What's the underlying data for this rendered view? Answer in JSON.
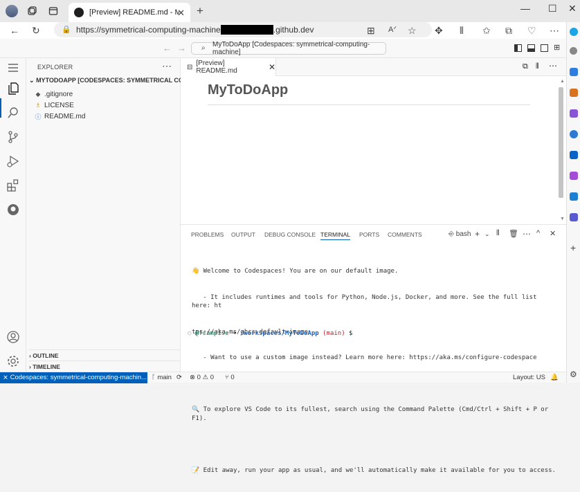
{
  "browser": {
    "tab_title": "[Preview] README.md - MyToDo",
    "url_prefix": "https://symmetrical-computing-machine",
    "url_suffix": ".github.dev"
  },
  "vscode": {
    "command_center": "MyToDoApp [Codespaces: symmetrical-computing-machine]",
    "sidebar": {
      "title": "EXPLORER",
      "folder": "MYTODOAPP [CODESPACES: SYMMETRICAL COMP...",
      "files": [
        {
          "name": ".gitignore",
          "icon": "git-icon"
        },
        {
          "name": "LICENSE",
          "icon": "license-icon"
        },
        {
          "name": "README.md",
          "icon": "info-icon"
        }
      ],
      "outline": "OUTLINE",
      "timeline": "TIMELINE"
    },
    "editor": {
      "tab_label": "[Preview] README.md",
      "heading": "MyToDoApp"
    },
    "panel": {
      "tabs": [
        "PROBLEMS",
        "OUTPUT",
        "DEBUG CONSOLE",
        "TERMINAL",
        "PORTS",
        "COMMENTS"
      ],
      "active_tab": "TERMINAL",
      "shell": "bash",
      "terminal_lines": [
        "👋 Welcome to Codespaces! You are on our default image.",
        "   - It includes runtimes and tools for Python, Node.js, Docker, and more. See the full list here: ht",
        "tps://aka.ms/ghcs-default-image",
        "   - Want to use a custom image instead? Learn more here: https://aka.ms/configure-codespace",
        "",
        "🔍 To explore VS Code to its fullest, search using the Command Palette (Cmd/Ctrl + Shift + P or F1).",
        "",
        "📝 Edit away, run your app as usual, and we'll automatically make it available for you to access."
      ],
      "prompt_user": "@fcampise",
      "prompt_arrow": "➜",
      "prompt_path": "/workspaces/MyToDoApp",
      "prompt_branch": "(main)",
      "prompt_symbol": "$"
    },
    "status": {
      "remote": "Codespaces: symmetrical-computing-machin...",
      "branch": "main",
      "errors": "0",
      "warnings": "0",
      "ports": "0",
      "layout": "Layout: US"
    }
  },
  "colors": {
    "accent": "#005fb8",
    "status_remote_bg": "#005fb8"
  }
}
